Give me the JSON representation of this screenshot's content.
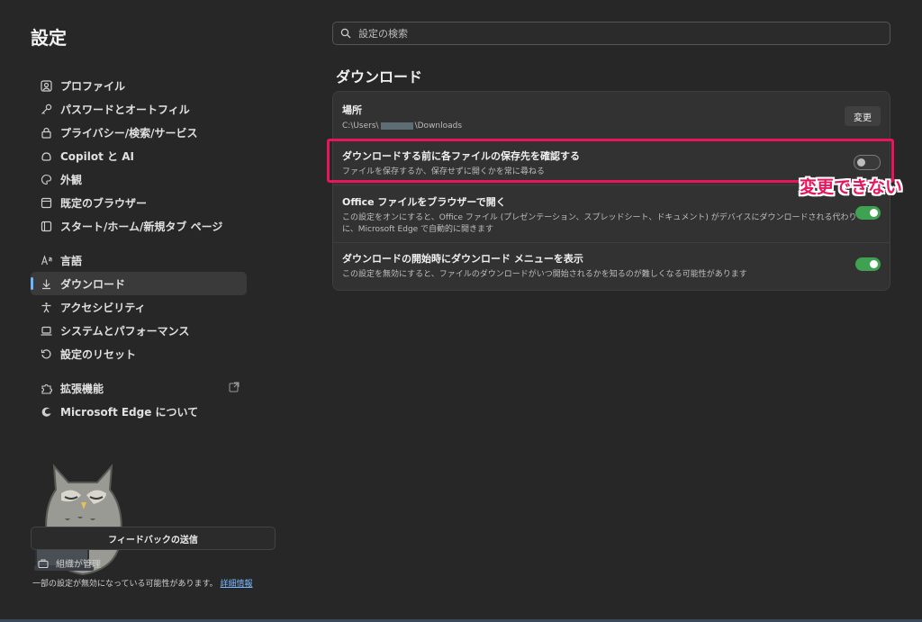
{
  "app": {
    "title": "設定"
  },
  "search": {
    "placeholder": "設定の検索"
  },
  "sidebar": {
    "items": [
      {
        "label": "プロファイル",
        "icon": "profile-icon"
      },
      {
        "label": "パスワードとオートフィル",
        "icon": "key-icon"
      },
      {
        "label": "プライバシー/検索/サービス",
        "icon": "lock-icon"
      },
      {
        "label": "Copilot と AI",
        "icon": "copilot-icon"
      },
      {
        "label": "外観",
        "icon": "palette-icon"
      },
      {
        "label": "既定のブラウザー",
        "icon": "browser-icon"
      },
      {
        "label": "スタート/ホーム/新規タブ ページ",
        "icon": "home-icon"
      },
      {
        "label": "言語",
        "icon": "language-icon"
      },
      {
        "label": "ダウンロード",
        "icon": "download-icon",
        "active": true
      },
      {
        "label": "アクセシビリティ",
        "icon": "accessibility-icon"
      },
      {
        "label": "システムとパフォーマンス",
        "icon": "laptop-icon"
      },
      {
        "label": "設定のリセット",
        "icon": "reset-icon"
      },
      {
        "label": "拡張機能",
        "icon": "extensions-icon"
      },
      {
        "label": "Microsoft Edge について",
        "icon": "edge-icon"
      }
    ]
  },
  "main": {
    "section_title": "ダウンロード",
    "location": {
      "title": "場所",
      "path_prefix": "C:\\Users\\",
      "path_suffix": "\\Downloads",
      "change_label": "変更"
    },
    "settings": [
      {
        "title": "ダウンロードする前に各ファイルの保存先を確認する",
        "desc": "ファイルを保存するか、保存せずに開くかを常に尋ねる",
        "enabled": false
      },
      {
        "title": "Office ファイルをブラウザーで開く",
        "desc": "この設定をオンにすると、Office ファイル (プレゼンテーション、スプレッドシート、ドキュメント) がデバイスにダウンロードされる代わりに、Microsoft Edge で自動的に開きます",
        "enabled": true
      },
      {
        "title": "ダウンロードの開始時にダウンロード メニューを表示",
        "desc": "この設定を無効にすると、ファイルのダウンロードがいつ開始されるかを知るのが難しくなる可能性があります",
        "enabled": true
      }
    ]
  },
  "annotation": {
    "callout": "変更できない",
    "color": "#e8145c"
  },
  "footer": {
    "feedback_label": "フィードバックの送信",
    "managed_label": "組織が管理",
    "note": "一部の設定が無効になっている可能性があります。",
    "link": "詳細情報"
  },
  "colors": {
    "accent": "#6cb6ff",
    "toggle_on": "#3fa152",
    "background": "#272727"
  }
}
